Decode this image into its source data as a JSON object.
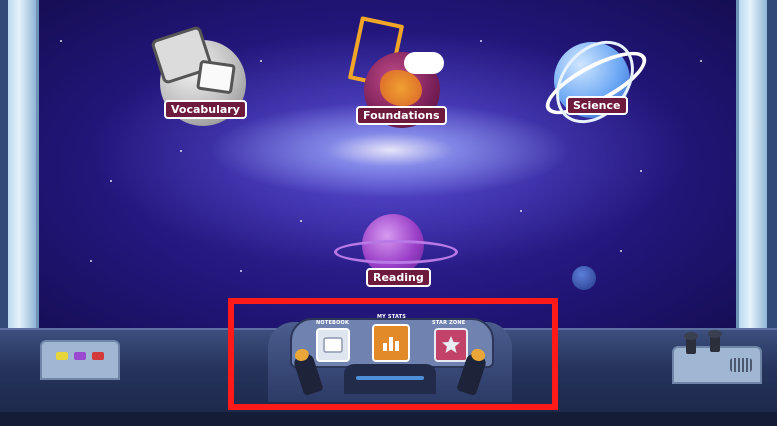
{
  "planets": {
    "vocabulary": {
      "label": "Vocabulary"
    },
    "foundations": {
      "label": "Foundations"
    },
    "science": {
      "label": "Science"
    },
    "reading": {
      "label": "Reading"
    }
  },
  "dashboard": {
    "notes_label": "NOTEBOOK",
    "stats_label": "MY STATS",
    "stars_label": "STAR ZONE"
  },
  "colors": {
    "highlight": "#ff1a1a",
    "label_bg": "#6e1a3c",
    "stats_button": "#e28a2a",
    "star_button": "#d1375d"
  },
  "icons": {
    "notes": "notepad-icon",
    "stats": "bar-chart-icon",
    "star": "star-icon"
  }
}
